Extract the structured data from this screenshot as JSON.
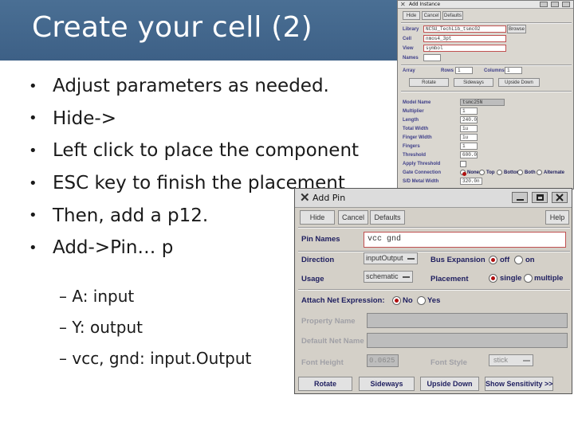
{
  "slide": {
    "title": "Create your cell (2)",
    "bullets": [
      "Adjust parameters as needed.",
      "Hide->",
      "Left click to place the component",
      "ESC key to finish the placement",
      "Then, add a p12.",
      "Add->Pin… p"
    ],
    "bullet_glyph": "•",
    "sub_bullets": [
      "– A: input",
      "– Y: output",
      "– vcc, gnd: input.Output"
    ]
  },
  "add_instance": {
    "title": "Add Instance",
    "top_buttons": [
      "Hide",
      "Cancel",
      "Defaults"
    ],
    "library_label": "Library",
    "library_value": "NCSU_TechLib_tsmc02",
    "browse_label": "Browse",
    "cell_label": "Cell",
    "cell_value": "nmos4_3pt",
    "view_label": "View",
    "view_value": "symbol",
    "names_label": "Names",
    "array_label": "Array",
    "rows_label": "Rows",
    "rows_value": "1",
    "columns_label": "Columns",
    "columns_value": "1",
    "transform_buttons": [
      "Rotate",
      "Sideways",
      "Upside Down"
    ],
    "params": [
      {
        "label": "Model Name",
        "value": "tsmc25N"
      },
      {
        "label": "Multiplier",
        "value": "1"
      },
      {
        "label": "Length",
        "value": "240.0n"
      },
      {
        "label": "Total Width",
        "value": "1u"
      },
      {
        "label": "Finger Width",
        "value": "1u"
      },
      {
        "label": "Fingers",
        "value": "1"
      },
      {
        "label": "Threshold",
        "value": "600.0m"
      },
      {
        "label": "Apply Threshold",
        "value": ""
      },
      {
        "label": "Gate Connection",
        "value": ""
      },
      {
        "label": "S/D Metal Width",
        "value": "320.0n"
      }
    ],
    "gate_options": [
      "None",
      "Top",
      "Bottom",
      "Both",
      "Alternate"
    ]
  },
  "add_pin": {
    "title": "Add Pin",
    "buttons": {
      "hide": "Hide",
      "cancel": "Cancel",
      "defaults": "Defaults",
      "help": "Help"
    },
    "pin_names_label": "Pin Names",
    "pin_names_value": "vcc gnd",
    "direction_label": "Direction",
    "direction_value": "inputOutput",
    "bus_expansion_label": "Bus Expansion",
    "bus_off": "off",
    "bus_on": "on",
    "usage_label": "Usage",
    "usage_value": "schematic",
    "placement_label": "Placement",
    "placement_single": "single",
    "placement_multiple": "multiple",
    "attach_label": "Attach Net Expression:",
    "attach_no": "No",
    "attach_yes": "Yes",
    "property_name_label": "Property Name",
    "default_net_label": "Default Net Name",
    "font_height_label": "Font Height",
    "font_height_value": "0.0625",
    "font_style_label": "Font Style",
    "font_style_value": "stick",
    "bottom_buttons": {
      "rotate": "Rotate",
      "sideways": "Sideways",
      "upside_down": "Upside Down",
      "show_sensitivity": "Show Sensitivity >>"
    }
  },
  "colors": {
    "header_band": "#3d6086",
    "dialog_bg": "#d4d0c8",
    "radio_dot": "#b01010",
    "label_text": "#202060"
  }
}
